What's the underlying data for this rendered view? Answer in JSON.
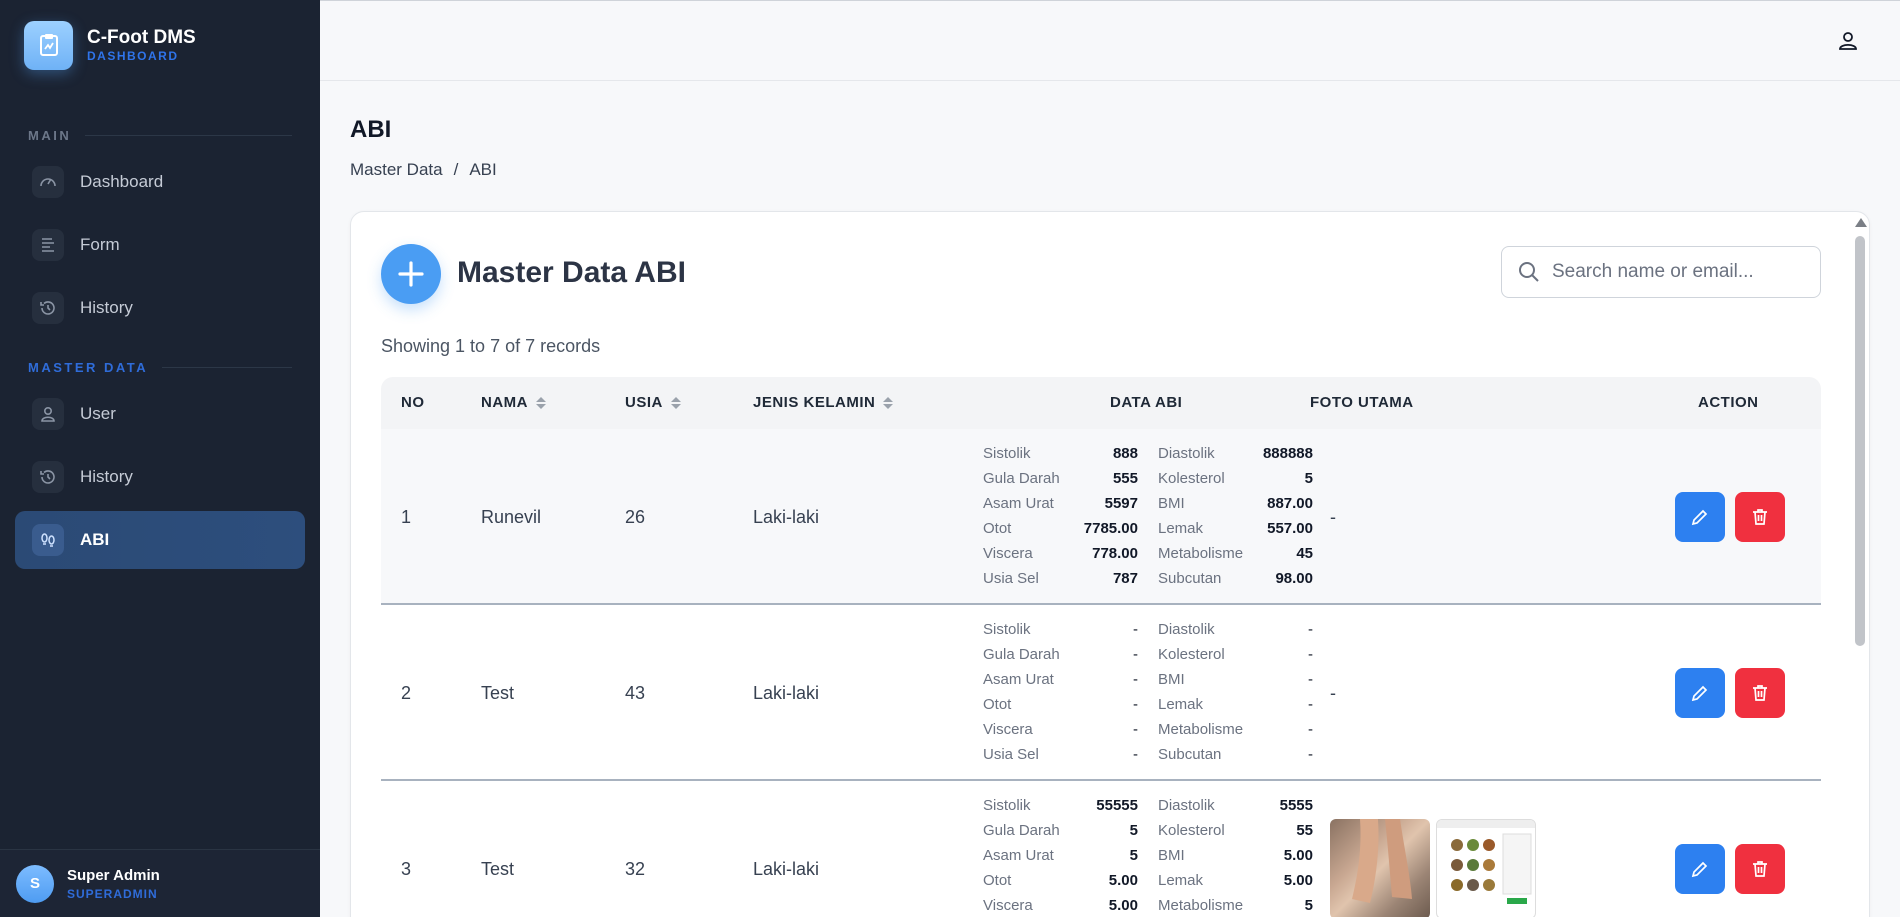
{
  "brand": {
    "title": "C-Foot DMS",
    "subtitle": "DASHBOARD"
  },
  "sidebar": {
    "main_label": "MAIN",
    "master_label": "MASTER DATA",
    "items": [
      {
        "label": "Dashboard",
        "icon": "gauge-icon"
      },
      {
        "label": "Form",
        "icon": "form-icon"
      },
      {
        "label": "History",
        "icon": "history-icon"
      },
      {
        "label": "User",
        "icon": "user-icon"
      },
      {
        "label": "History",
        "icon": "history-icon"
      },
      {
        "label": "ABI",
        "icon": "footprints-icon"
      }
    ]
  },
  "user": {
    "initial": "S",
    "name": "Super Admin",
    "role": "SUPERADMIN"
  },
  "page": {
    "title": "ABI",
    "breadcrumb": [
      "Master Data",
      "/",
      "ABI"
    ]
  },
  "card": {
    "title": "Master Data ABI",
    "search_placeholder": "Search name or email...",
    "records_info": "Showing 1 to 7 of 7 records"
  },
  "table": {
    "headers": [
      "NO",
      "NAMA",
      "USIA",
      "JENIS KELAMIN",
      "DATA ABI",
      "FOTO UTAMA",
      "ACTION"
    ],
    "rows": [
      {
        "no": "1",
        "nama": "Runevil",
        "usia": "26",
        "jk": "Laki-laki",
        "abi": [
          [
            "Sistolik",
            "888",
            "Diastolik",
            "888888"
          ],
          [
            "Gula Darah",
            "555",
            "Kolesterol",
            "5"
          ],
          [
            "Asam Urat",
            "5597",
            "BMI",
            "887.00"
          ],
          [
            "Otot",
            "7785.00",
            "Lemak",
            "557.00"
          ],
          [
            "Viscera",
            "778.00",
            "Metabolisme",
            "45"
          ],
          [
            "Usia Sel",
            "787",
            "Subcutan",
            "98.00"
          ]
        ],
        "foto": "-"
      },
      {
        "no": "2",
        "nama": "Test",
        "usia": "43",
        "jk": "Laki-laki",
        "abi": [
          [
            "Sistolik",
            "-",
            "Diastolik",
            "-"
          ],
          [
            "Gula Darah",
            "-",
            "Kolesterol",
            "-"
          ],
          [
            "Asam Urat",
            "-",
            "BMI",
            "-"
          ],
          [
            "Otot",
            "-",
            "Lemak",
            "-"
          ],
          [
            "Viscera",
            "-",
            "Metabolisme",
            "-"
          ],
          [
            "Usia Sel",
            "-",
            "Subcutan",
            "-"
          ]
        ],
        "foto": "-"
      },
      {
        "no": "3",
        "nama": "Test",
        "usia": "32",
        "jk": "Laki-laki",
        "abi": [
          [
            "Sistolik",
            "55555",
            "Diastolik",
            "5555"
          ],
          [
            "Gula Darah",
            "5",
            "Kolesterol",
            "55"
          ],
          [
            "Asam Urat",
            "5",
            "BMI",
            "5.00"
          ],
          [
            "Otot",
            "5.00",
            "Lemak",
            "5.00"
          ],
          [
            "Viscera",
            "5.00",
            "Metabolisme",
            "5"
          ]
        ],
        "foto": ""
      }
    ]
  },
  "colors": {
    "sidebar_bg": "#1b2332",
    "accent": "#4a9df3",
    "edit": "#2d80f0",
    "delete": "#f0303f"
  }
}
